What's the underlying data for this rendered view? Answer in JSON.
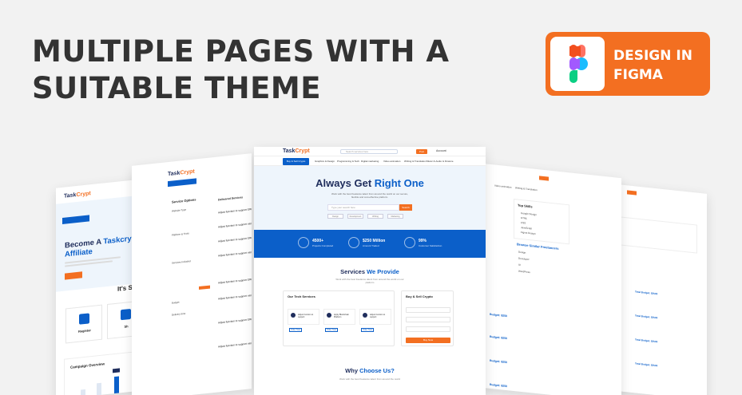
{
  "headline": {
    "line1": "MULTIPLE PAGES WITH A",
    "line2": "SUITABLE THEME"
  },
  "badge": {
    "line1": "DESIGN IN",
    "line2": "FIGMA",
    "bg_color": "#f36f21",
    "icon": "figma-logo-icon"
  },
  "colors": {
    "primary_blue": "#0b5fc9",
    "accent_orange": "#f36f21",
    "navy": "#1f2d5c"
  },
  "brand": {
    "name_a": "Task",
    "name_b": "Crypt"
  },
  "center_page": {
    "search_placeholder": "Search services here",
    "post_button": "Post",
    "account_label": "Account",
    "category_button": "Buy & Sell Crypto",
    "nav_items": [
      "Graphics & Design",
      "Programming & Tech",
      "Digital marketing",
      "Video animation",
      "Writing & Translation",
      "Music & Audio",
      "& Finance"
    ],
    "hero_title_a": "Always Get ",
    "hero_title_b": "Right One",
    "hero_sub": "Work with the best freelance talent from around the world on our secure, flexible and cost-effective platform.",
    "hero_input_placeholder": "Type your search here",
    "hero_search_button": "Search",
    "hero_chips": [
      "Design",
      "Development",
      "Writing",
      "Marketing"
    ],
    "stats": [
      {
        "value": "4500+",
        "label": "Projects Completed"
      },
      {
        "value": "$250 Million",
        "label": "Amount Traded"
      },
      {
        "value": "99%",
        "label": "Customer Satisfaction"
      }
    ],
    "services_title_a": "Services ",
    "services_title_b": "We Provide",
    "services_sub": "Work with the best freelance talent from around the world on our platform",
    "our_services_title": "Our Tech Services",
    "service_cards": [
      {
        "title": "Adjust function to support",
        "btn": "Order Now"
      },
      {
        "title": "Apply Blockchain Platform",
        "btn": "Order Now"
      },
      {
        "title": "Adjust function to support",
        "btn": "Order Now"
      }
    ],
    "buy_sell_title": "Buy & Sell Crypto",
    "buy_sell_button": "Buy Now",
    "why_title_a": "Why ",
    "why_title_b": "Choose Us?",
    "why_sub": "Work with the best freelance talent from around the world"
  },
  "left_page": {
    "category_button": "Buy & Sell Crypto",
    "title_a": "Become A ",
    "title_b": "Taskcry",
    "title_line2": "Affiliate",
    "its_label": "It's Si",
    "cards": [
      {
        "label": "Register"
      },
      {
        "label": "Sh"
      }
    ],
    "campaign_title": "Campaign Overview"
  },
  "left2_page": {
    "category_button": "Buy & Sell Crypto",
    "filters_title": "Service Options",
    "filter_items": [
      "Website Type",
      "Platform & Tools",
      "Services Included",
      "Budget",
      "Delivery time"
    ],
    "list_title": "Delivered Services",
    "list_items": [
      "Adjust function to support ERC20",
      "Adjust function to support variable",
      "Adjust function to support ERC20",
      "Adjust function to support variable",
      "Adjust function to support ERC20",
      "Adjust function to support variable",
      "Adjust function to support ERC20",
      "Adjust function to support variable"
    ]
  },
  "right_page": {
    "top_skills_title": "Top Skills",
    "skills": [
      "Google Design",
      "HTML",
      "CSS",
      "JavaScript",
      "Figma Design"
    ],
    "similar_title": "Browse Similar Freelancers",
    "similar_items": [
      "Design",
      "Developer",
      "UI",
      "WordPress"
    ],
    "post_tags": [
      "Budget: $250",
      "Budget: $250",
      "Budget: $250",
      "Budget: $250"
    ]
  },
  "right2_page": {
    "budget_rows": [
      "Total Budget: $2500",
      "Total Budget: $2500",
      "Total Budget: $2500",
      "Total Budget: $2500"
    ]
  }
}
